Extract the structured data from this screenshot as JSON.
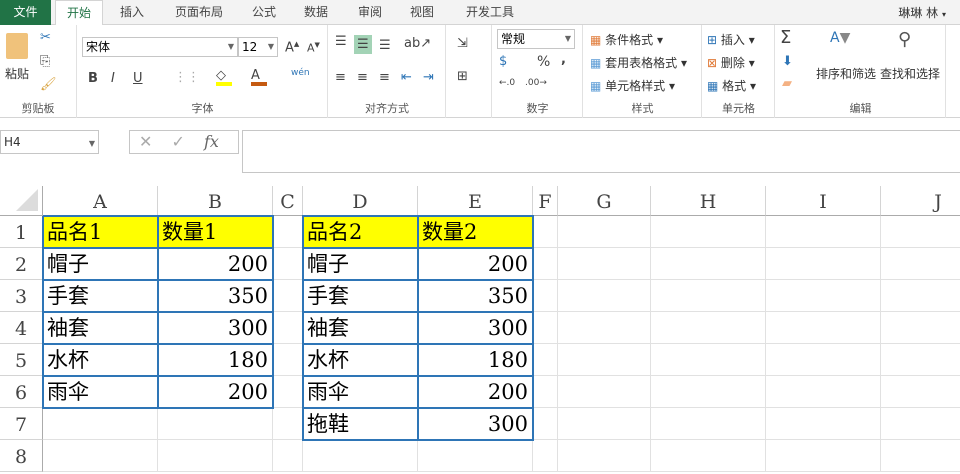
{
  "tabs": [
    "文件",
    "开始",
    "插入",
    "页面布局",
    "公式",
    "数据",
    "审阅",
    "视图",
    "开发工具"
  ],
  "user": "琳琳 林",
  "ribbon": {
    "clipboard": {
      "label": "剪贴板",
      "paste": "粘贴"
    },
    "font": {
      "label": "字体",
      "name": "宋体",
      "size": "12",
      "phonetic": "wén"
    },
    "align": {
      "label": "对齐方式"
    },
    "number": {
      "label": "数字",
      "format": "常规",
      "percent": "%",
      "comma": ","
    },
    "styles": {
      "label": "样式",
      "conditional": "条件格式",
      "table": "套用表格格式",
      "cell": "单元格样式"
    },
    "cells": {
      "label": "单元格",
      "insert": "插入",
      "delete": "删除",
      "format": "格式"
    },
    "editing": {
      "label": "编辑",
      "sum": "Σ",
      "sort": "排序和筛选",
      "find": "查找和选择"
    }
  },
  "formula": {
    "namebox": "H4",
    "fx": "fx",
    "value": ""
  },
  "columns": [
    "A",
    "B",
    "C",
    "D",
    "E",
    "F",
    "G",
    "H",
    "I",
    "J"
  ],
  "rows": [
    "1",
    "2",
    "3",
    "4",
    "5",
    "6",
    "7",
    "8"
  ],
  "table1": {
    "headers": [
      "品名1",
      "数量1"
    ],
    "rows": [
      [
        "帽子",
        "200"
      ],
      [
        "手套",
        "350"
      ],
      [
        "袖套",
        "300"
      ],
      [
        "水杯",
        "180"
      ],
      [
        "雨伞",
        "200"
      ]
    ]
  },
  "table2": {
    "headers": [
      "品名2",
      "数量2"
    ],
    "rows": [
      [
        "帽子",
        "200"
      ],
      [
        "手套",
        "350"
      ],
      [
        "袖套",
        "300"
      ],
      [
        "水杯",
        "180"
      ],
      [
        "雨伞",
        "200"
      ],
      [
        "拖鞋",
        "300"
      ]
    ]
  },
  "colors": {
    "accent": "#217346",
    "header_fill": "#ffff00",
    "border": "#2e75b6"
  }
}
